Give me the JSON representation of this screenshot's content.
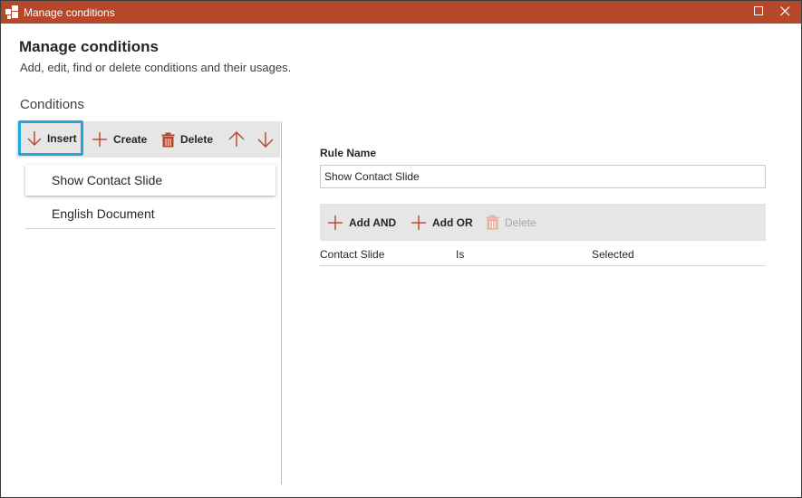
{
  "window": {
    "title": "Manage conditions",
    "app_icon": "app-puzzle-icon",
    "controls": [
      "maximize-icon",
      "close-icon"
    ]
  },
  "header": {
    "title": "Manage conditions",
    "subtitle": "Add, edit, find or delete conditions and their usages."
  },
  "conditions": {
    "section_label": "Conditions",
    "toolbar": {
      "insert_label": "Insert",
      "create_label": "Create",
      "delete_label": "Delete"
    },
    "items": [
      {
        "label": "Show Contact Slide",
        "selected": true
      },
      {
        "label": "English Document",
        "selected": false
      }
    ]
  },
  "rule": {
    "name_label": "Rule Name",
    "name_value": "Show Contact Slide",
    "toolbar": {
      "add_and_label": "Add AND",
      "add_or_label": "Add OR",
      "delete_label": "Delete"
    },
    "rows": [
      {
        "field": "Contact Slide",
        "operator": "Is",
        "value": "Selected"
      }
    ]
  },
  "colors": {
    "titlebar": "#b7472a",
    "accent_icon": "#b7472a",
    "focus_border": "#1ea7d9",
    "toolbar_bg": "#e6e6e6"
  }
}
